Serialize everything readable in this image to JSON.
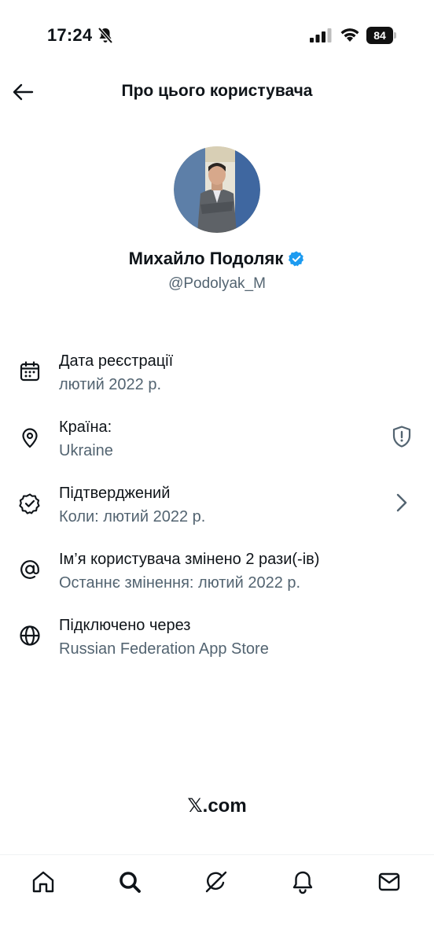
{
  "status_bar": {
    "time": "17:24",
    "battery": "84"
  },
  "header": {
    "title": "Про цього користувача"
  },
  "profile": {
    "display_name": "Михайло Подоляк",
    "handle": "@Podolyak_M"
  },
  "info": [
    {
      "title": "Дата реєстрації",
      "subtitle": "лютий 2022 р.",
      "icon": "calendar-icon"
    },
    {
      "title": "Країна:",
      "subtitle": "Ukraine",
      "icon": "location-pin-icon",
      "right_icon": "shield-alert-icon"
    },
    {
      "title": "Підтверджений",
      "subtitle": "Коли: лютий 2022 р.",
      "icon": "verified-badge-outline-icon",
      "right_icon": "chevron-right-icon"
    },
    {
      "title": "Ім’я користувача змінено 2 рази(-ів)",
      "subtitle": "Останнє змінення: лютий 2022 р.",
      "icon": "at-sign-icon"
    },
    {
      "title": "Підключено через",
      "subtitle": "Russian Federation App Store",
      "icon": "globe-icon"
    }
  ],
  "footer": {
    "brand": "𝕏.com"
  },
  "tabs": [
    "home-icon",
    "search-icon",
    "grok-icon",
    "notifications-icon",
    "messages-icon"
  ],
  "colors": {
    "verified": "#1d9bf0",
    "secondary_text": "#536471",
    "primary_text": "#0f1419"
  }
}
